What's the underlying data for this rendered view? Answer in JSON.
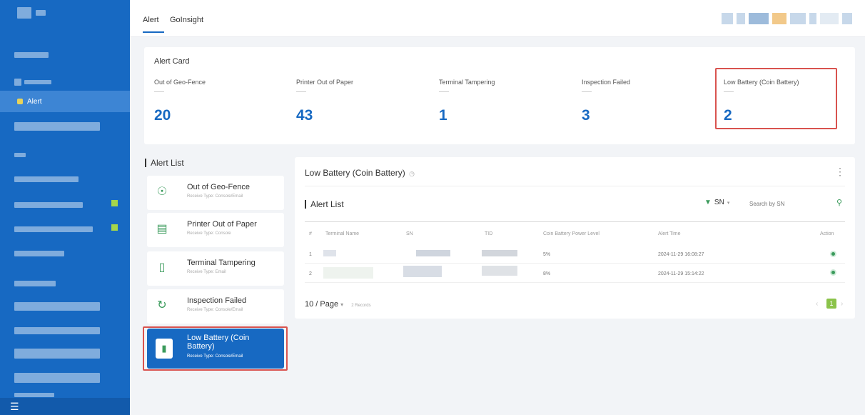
{
  "tabs": [
    {
      "label": "Alert",
      "active": true
    },
    {
      "label": "GoInsight",
      "active": false
    }
  ],
  "sidebar": {
    "active_label": "Alert",
    "footer_icon": "menu-icon"
  },
  "alert_card": {
    "title": "Alert Card",
    "items": [
      {
        "label": "Out of Geo-Fence",
        "value": "20"
      },
      {
        "label": "Printer Out of Paper",
        "value": "43"
      },
      {
        "label": "Terminal Tampering",
        "value": "1"
      },
      {
        "label": "Inspection Failed",
        "value": "3"
      },
      {
        "label": "Low Battery (Coin Battery)",
        "value": "2"
      }
    ]
  },
  "alert_list": {
    "title": "Alert List",
    "items": [
      {
        "name": "Out of Geo-Fence",
        "receive": "Receive Type:  Console/Email",
        "icon": "geofence-icon"
      },
      {
        "name": "Printer Out of Paper",
        "receive": "Receive Type:  Console",
        "icon": "printer-icon"
      },
      {
        "name": "Terminal Tampering",
        "receive": "Receive Type:  Email",
        "icon": "terminal-icon"
      },
      {
        "name": "Inspection Failed",
        "receive": "Receive Type:  Console/Email",
        "icon": "inspection-icon"
      },
      {
        "name": "Low Battery (Coin Battery)",
        "receive": "Receive Type:  Console/Email",
        "icon": "battery-icon",
        "active": true
      }
    ]
  },
  "detail": {
    "title": "Low Battery (Coin Battery)",
    "list_title": "Alert List",
    "filter_field": "SN",
    "search_placeholder": "Search by SN",
    "columns": [
      "#",
      "Terminal Name",
      "SN",
      "TID",
      "Coin Battery Power Level",
      "Alert Time",
      "Action"
    ],
    "rows": [
      {
        "index": "1",
        "power": "5%",
        "time": "2024-11-29 16:08:27"
      },
      {
        "index": "2",
        "power": "8%",
        "time": "2024-11-29 15:14:22"
      }
    ],
    "page_size": "10 / Page",
    "records": "2 Records",
    "current_page": "1"
  },
  "colors": {
    "sidebar": "#1769c2",
    "accent": "#1769c2",
    "green": "#3a9a5b",
    "highlight": "#d9534f"
  }
}
